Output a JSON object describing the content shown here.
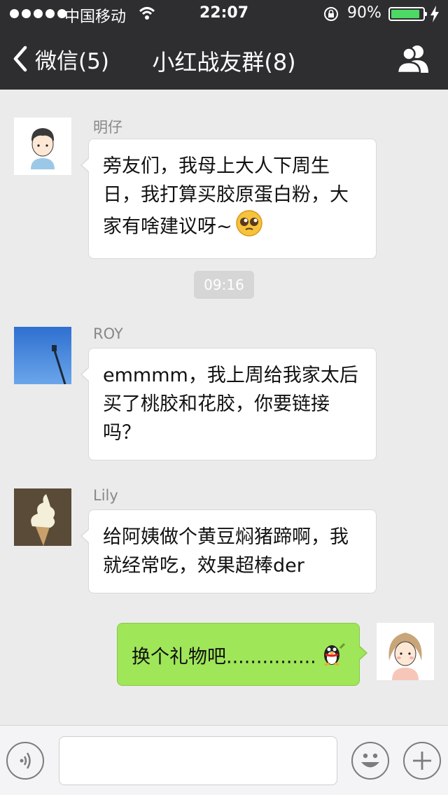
{
  "status_bar": {
    "carrier": "中国移动",
    "time": "22:07",
    "battery_percent": "90%",
    "battery_level": 0.9
  },
  "nav": {
    "back_label": "微信(5)",
    "title": "小红战友群(8)"
  },
  "messages": [
    {
      "sender": "明仔",
      "text": "旁友们，我母上大人下周生日，我打算买胶原蛋白粉，大家有啥建议呀~",
      "emoji": "pleading-face"
    },
    {
      "timestamp": "09:16"
    },
    {
      "sender": "ROY",
      "text": "emmmm，我上周给我家太后买了桃胶和花胶，你要链接吗？"
    },
    {
      "sender": "Lily",
      "text": "给阿姨做个黄豆焖猪蹄啊，我就经常吃，效果超棒der"
    },
    {
      "sender": "me",
      "text": "换个礼物吧...............",
      "emoji": "penguin-sticker"
    }
  ],
  "input": {
    "value": ""
  },
  "colors": {
    "header_bg": "#2e2e30",
    "chat_bg": "#ebebeb",
    "my_bubble": "#9fe658",
    "battery_fill": "#4cd964"
  }
}
